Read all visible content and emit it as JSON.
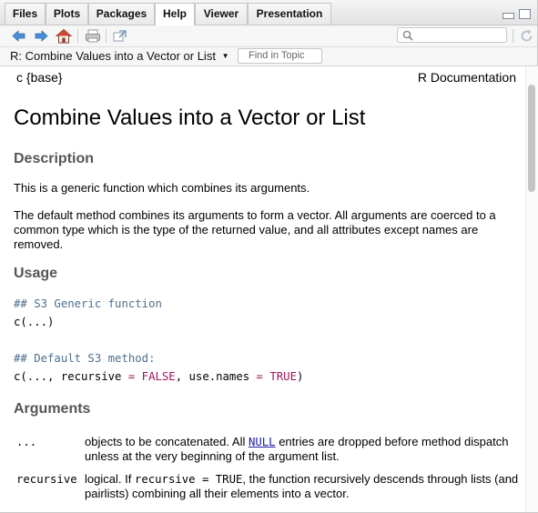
{
  "tabs": [
    {
      "label": "Files"
    },
    {
      "label": "Plots"
    },
    {
      "label": "Packages"
    },
    {
      "label": "Help"
    },
    {
      "label": "Viewer"
    },
    {
      "label": "Presentation"
    }
  ],
  "active_tab": "Help",
  "toolbar": {
    "icons": [
      "back-arrow-icon",
      "forward-arrow-icon",
      "home-icon",
      "print-icon",
      "popout-icon",
      "refresh-icon"
    ],
    "search_placeholder": ""
  },
  "topic_bar": {
    "topic": "R: Combine Values into a Vector or List",
    "find_placeholder": "Find in Topic"
  },
  "doc": {
    "package": "c {base}",
    "rdoc": "R Documentation",
    "title": "Combine Values into a Vector or List",
    "description_heading": "Description",
    "desc_p1": "This is a generic function which combines its arguments.",
    "desc_p2": "The default method combines its arguments to form a vector. All arguments are coerced to a common type which is the type of the returned value, and all attributes except names are removed.",
    "usage_heading": "Usage",
    "usage": {
      "comment1": "## S3 Generic function",
      "line1": "c(...)",
      "comment2": "## Default S3 method:",
      "line2_a": "c(..., recursive ",
      "eq1": "=",
      "false": "FALSE",
      "line2_b": ", use.names ",
      "eq2": "=",
      "true": "TRUE",
      "line2_c": ")"
    },
    "arguments_heading": "Arguments",
    "args": [
      {
        "name": "...",
        "desc_a": "objects to be concatenated. All ",
        "link": "NULL",
        "desc_b": " entries are dropped before method dispatch unless at the very beginning of the argument list."
      },
      {
        "name": "recursive",
        "desc_a": "logical. If ",
        "code": "recursive = TRUE",
        "desc_b": ", the function recursively descends through lists (and pairlists) combining all their elements into a vector."
      }
    ]
  },
  "colors": {
    "heading": "#555555",
    "comment": "#4f6f8f",
    "keyword": "#a3145a",
    "link": "#1a1aa6"
  }
}
